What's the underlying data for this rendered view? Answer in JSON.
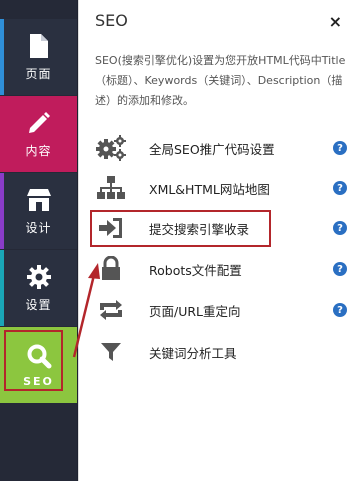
{
  "sidebar": {
    "items": [
      {
        "label": "页面",
        "icon": "page-icon"
      },
      {
        "label": "内容",
        "icon": "pencil-icon"
      },
      {
        "label": "设计",
        "icon": "store-icon"
      },
      {
        "label": "设置",
        "icon": "gear-icon"
      },
      {
        "label": "SEO",
        "icon": "search-icon"
      }
    ]
  },
  "panel": {
    "title": "SEO",
    "close": "×",
    "description": "SEO(搜索引擎优化)设置为您开放HTML代码中Title（标题）、Keywords（关键词）、Description（描述）的添加和修改。",
    "items": [
      {
        "label": "全局SEO推广代码设置",
        "icon": "gears-icon",
        "help": "?"
      },
      {
        "label": "XML&HTML网站地图",
        "icon": "sitemap-icon",
        "help": "?"
      },
      {
        "label": "提交搜索引擎收录",
        "icon": "sign-in-icon",
        "help": "?"
      },
      {
        "label": "Robots文件配置",
        "icon": "lock-icon",
        "help": "?"
      },
      {
        "label": "页面/URL重定向",
        "icon": "retweet-icon",
        "help": "?"
      },
      {
        "label": "关键词分析工具",
        "icon": "filter-icon"
      }
    ]
  },
  "colors": {
    "content_active": "#c01c5c",
    "seo_active": "#8cc63f",
    "highlight": "#b3262b",
    "help": "#2a6fc2"
  }
}
